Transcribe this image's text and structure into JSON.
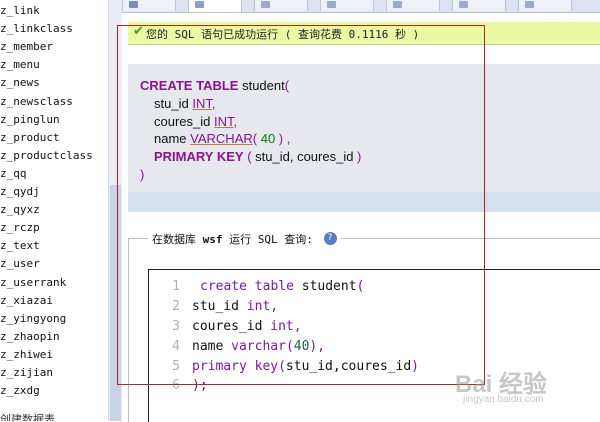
{
  "sidebar": {
    "tables": [
      "z_link",
      "z_linkclass",
      "z_member",
      "z_menu",
      "z_news",
      "z_newsclass",
      "z_pinglun",
      "z_product",
      "z_productclass",
      "z_qq",
      "z_qydj",
      "z_qyxz",
      "z_rczp",
      "z_text",
      "z_user",
      "z_userrank",
      "z_xiazai",
      "z_yingyong",
      "z_zhaopin",
      "z_zhiwei",
      "z_zijian",
      "z_zxdg"
    ],
    "bottom_partial": "创建数据表"
  },
  "success": {
    "message": "您的 SQL 语句已成功运行 ( 查询花费 0.1116 秒 )"
  },
  "formatted_sql": {
    "kw_create_table": "CREATE TABLE",
    "table_name": "student",
    "open_paren": "(",
    "col1_name": "stu_id",
    "col1_type": "INT",
    "col2_name": "coures_id",
    "col2_type": "INT",
    "col3_name": "name",
    "col3_type": "VARCHAR",
    "col3_len": "40",
    "kw_primary_key": "PRIMARY KEY",
    "pk_cols": "stu_id, coures_id",
    "close_paren": ")"
  },
  "query_box": {
    "legend_prefix": "在数据库",
    "database": "wsf",
    "legend_suffix": "运行 SQL 查询:",
    "help_glyph": "?"
  },
  "editor": {
    "line_numbers": [
      "1",
      "2",
      "3",
      "4",
      "5",
      "6"
    ],
    "l1_kw": "create table",
    "l1_id": "student",
    "l1_p": "(",
    "l2_id": "stu_id",
    "l2_kw": "int,",
    "l3_id": "coures_id",
    "l3_kw": "int,",
    "l4_id": "name",
    "l4_kw": "varchar",
    "l4_p1": "(",
    "l4_num": "40",
    "l4_p2": "),",
    "l5_kw": "primary key",
    "l5_p1": "(",
    "l5_id": "stu_id,coures_id",
    "l5_p2": ")",
    "l6_p": ");"
  },
  "watermark": {
    "text": "Bai 经验",
    "url": "jingyan.baidu.com"
  },
  "colors": {
    "success_bg": "#ebf8a4",
    "keyword": "#8a1390",
    "annotation_border": "#b22222"
  }
}
